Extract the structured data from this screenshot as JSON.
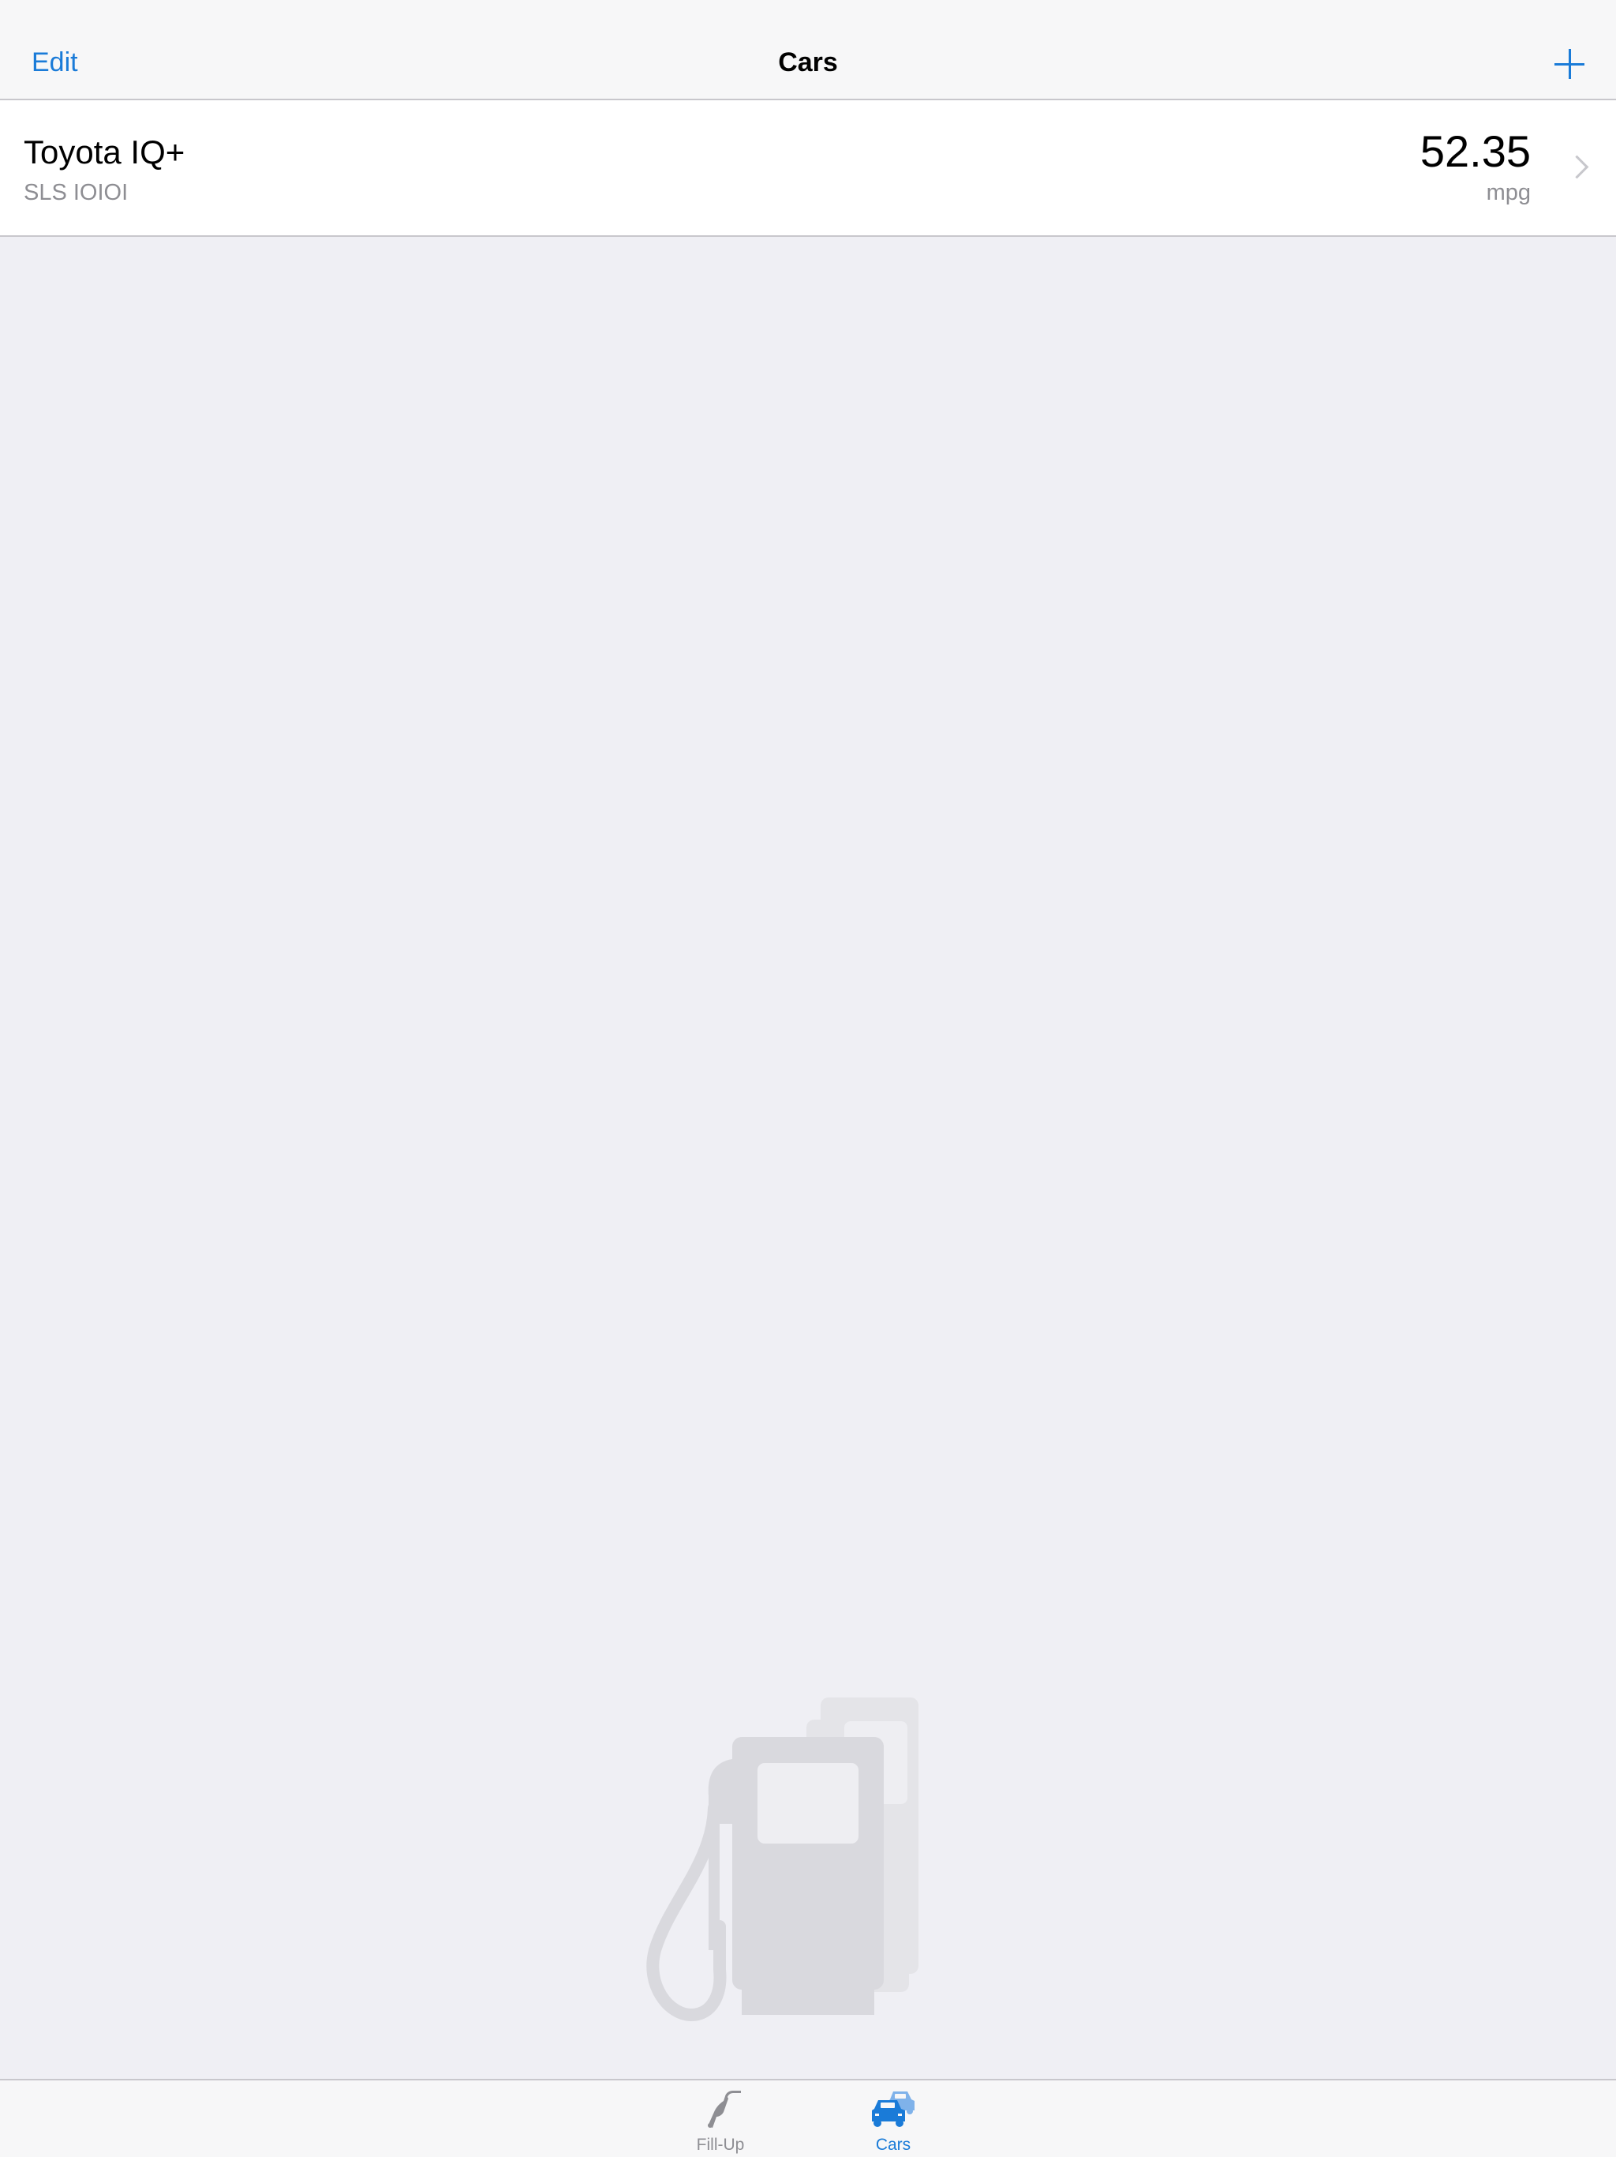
{
  "nav": {
    "title": "Cars",
    "edit_label": "Edit",
    "add_icon": "plus-icon"
  },
  "cars": [
    {
      "name": "Toyota IQ+",
      "subtitle": "SLS IOIOI",
      "value": "52.35",
      "unit": "mpg"
    }
  ],
  "tabs": [
    {
      "label": "Fill-Up",
      "icon": "fuel-nozzle-icon",
      "selected": false
    },
    {
      "label": "Cars",
      "icon": "cars-icon",
      "selected": true
    }
  ],
  "colors": {
    "accent": "#1a7bd8",
    "background": "#efeff4",
    "secondary_text": "#8e8e93",
    "illustration": "#d9d9de"
  }
}
